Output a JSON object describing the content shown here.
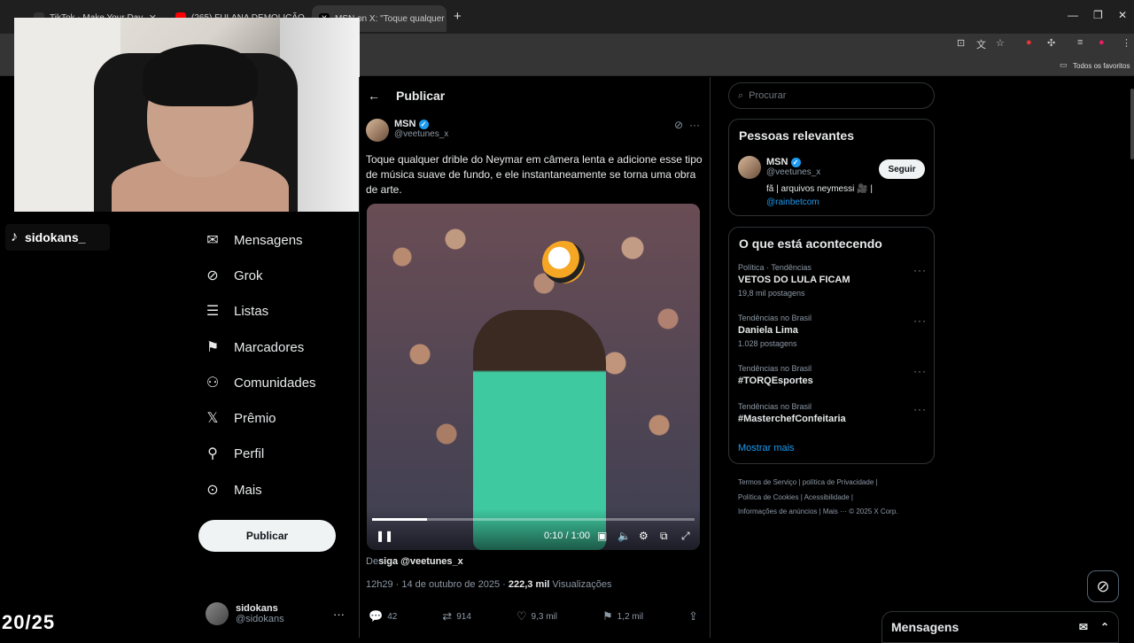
{
  "browser": {
    "tabs": [
      {
        "label": "TikTok - Make Your Day",
        "favicon_color": "#333333"
      },
      {
        "label": "(265) FULANA DEMOLIÇÃO DE",
        "favicon_color": "#ff0000"
      },
      {
        "label": "MSN on X: \"Toque qualquer",
        "favicon_color": "#000000"
      }
    ],
    "bookmarks_label": "Todos os favoritos"
  },
  "overlay": {
    "tiktok_handle": "sidokans_",
    "counter": "20/25"
  },
  "nav": {
    "items": [
      {
        "label": "Mensagens",
        "icon": "mail-icon"
      },
      {
        "label": "Grok",
        "icon": "grok-icon"
      },
      {
        "label": "Listas",
        "icon": "list-icon"
      },
      {
        "label": "Marcadores",
        "icon": "bookmark-icon"
      },
      {
        "label": "Comunidades",
        "icon": "communities-icon"
      },
      {
        "label": "Prêmio",
        "icon": "x-logo-icon"
      },
      {
        "label": "Perfil",
        "icon": "profile-icon"
      },
      {
        "label": "Mais",
        "icon": "more-icon"
      }
    ],
    "publish_label": "Publicar",
    "user": {
      "name": "sidokans",
      "handle": "@sidokans"
    }
  },
  "post": {
    "header_title": "Publicar",
    "author_name": "MSN",
    "author_handle": "@veetunes_x",
    "text": "Toque qualquer drible do Neymar em câmera lenta e adicione esse tipo de música suave de fundo, e ele instantaneamente se torna uma obra de arte.",
    "video": {
      "time": "0:10 / 1:00",
      "progress": 0.17
    },
    "follow_prefix": "De",
    "follow_text": "siga @veetunes_x",
    "timestamp": "12h29 · 14 de outubro de 2025 · ",
    "views_count": "222,3 mil",
    "views_label": " Visualizações",
    "stats": {
      "replies": "42",
      "reposts": "914",
      "likes": "9,3 mil",
      "bookmarks": "1,2 mil"
    }
  },
  "sidebar": {
    "search_placeholder": "Procurar",
    "relevant_title": "Pessoas relevantes",
    "relevant_user": {
      "name": "MSN",
      "handle": "@veetunes_x",
      "bio": "fã | arquivos neymessi 🎥 |",
      "link": "@rainbetcom",
      "follow_label": "Seguir"
    },
    "trends_title": "O que está acontecendo",
    "trends": [
      {
        "context": "Política · Tendências",
        "title": "VETOS DO LULA FICAM",
        "count": "19,8 mil postagens"
      },
      {
        "context": "Tendências no Brasil",
        "title": "Daniela Lima",
        "count": "1.028 postagens"
      },
      {
        "context": "Tendências no Brasil",
        "title": "#TORQEsportes",
        "count": ""
      },
      {
        "context": "Tendências no Brasil",
        "title": "#MasterchefConfeitaria",
        "count": ""
      }
    ],
    "show_more": "Mostrar mais",
    "footer": [
      "Termos de Serviço  |   política de Privacidade  |",
      "Política de Cookies  |   Acessibilidade  |",
      "Informações de anúncios  |   Mais ···   © 2025 X Corp."
    ],
    "messages_label": "Mensagens"
  }
}
